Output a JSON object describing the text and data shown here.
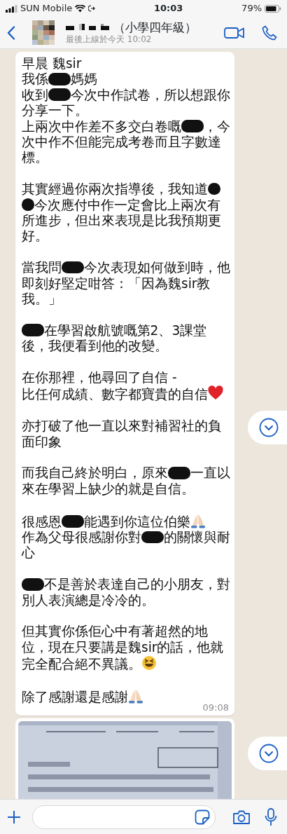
{
  "status_bar": {
    "carrier": "SUN Mobile",
    "time": "10:03",
    "battery": "79%"
  },
  "header": {
    "title": "（小學四年級）",
    "subtitle": "最後上線於今天 10:02"
  },
  "message": {
    "blocks": [
      [
        {
          "parts": [
            "早晨 魏sir"
          ]
        },
        {
          "parts": [
            "我係",
            {
              "kind": "redaction"
            },
            "媽媽"
          ]
        },
        {
          "parts": [
            "收到",
            {
              "kind": "redaction"
            },
            "今次中作試卷，所以想跟你分享一下。"
          ]
        },
        {
          "parts": [
            "上兩次中作差不多交白卷嘅",
            {
              "kind": "redaction"
            },
            "，今次中作不但能完成考卷而且字數達標。"
          ]
        }
      ],
      [
        {
          "parts": [
            "其實經過你兩次指導後，我知道",
            {
              "kind": "dot"
            },
            {
              "kind": "dot"
            },
            "今次應付中作一定會比上兩次有所進步，但出來表現是比我預期更好。"
          ]
        }
      ],
      [
        {
          "parts": [
            "當我問",
            {
              "kind": "redaction"
            },
            "今次表現如何做到時，他即刻好堅定咁答：「因為魏sir教我。」"
          ]
        }
      ],
      [
        {
          "parts": [
            {
              "kind": "redaction"
            },
            "在學習啟航號嘅第2、3課堂後，我便看到他的改變。"
          ]
        }
      ],
      [
        {
          "parts": [
            "在你那裡，他尋回了自信 -"
          ]
        },
        {
          "parts": [
            "比任何成績、數字都寶貴的自信",
            {
              "kind": "heart"
            }
          ]
        }
      ],
      [
        {
          "parts": [
            "亦打破了他一直以來對補習社的負面印象"
          ]
        }
      ],
      [
        {
          "parts": [
            "而我自己終於明白，原來",
            {
              "kind": "redaction"
            },
            "一直以來在學習上缺少的就是自信。"
          ]
        }
      ],
      [
        {
          "parts": [
            "很感恩",
            {
              "kind": "redaction"
            },
            "能遇到你這位伯樂",
            {
              "kind": "pray"
            }
          ]
        },
        {
          "parts": [
            "作為父母很感謝你對",
            {
              "kind": "redaction"
            },
            "的關懷與耐心"
          ]
        }
      ],
      [
        {
          "parts": [
            {
              "kind": "redaction"
            },
            "不是善於表達自己的小朋友，對別人表演總是冷冷的。"
          ]
        }
      ],
      [
        {
          "parts": [
            "但其實你係佢心中有著超然的地位，現在只要講是魏sir的話，他就完全配合絕不異議。",
            {
              "kind": "laugh"
            }
          ]
        }
      ],
      [
        {
          "parts": [
            "除了感謝還是感謝",
            {
              "kind": "pray"
            }
          ]
        }
      ]
    ],
    "time": "09:08"
  }
}
